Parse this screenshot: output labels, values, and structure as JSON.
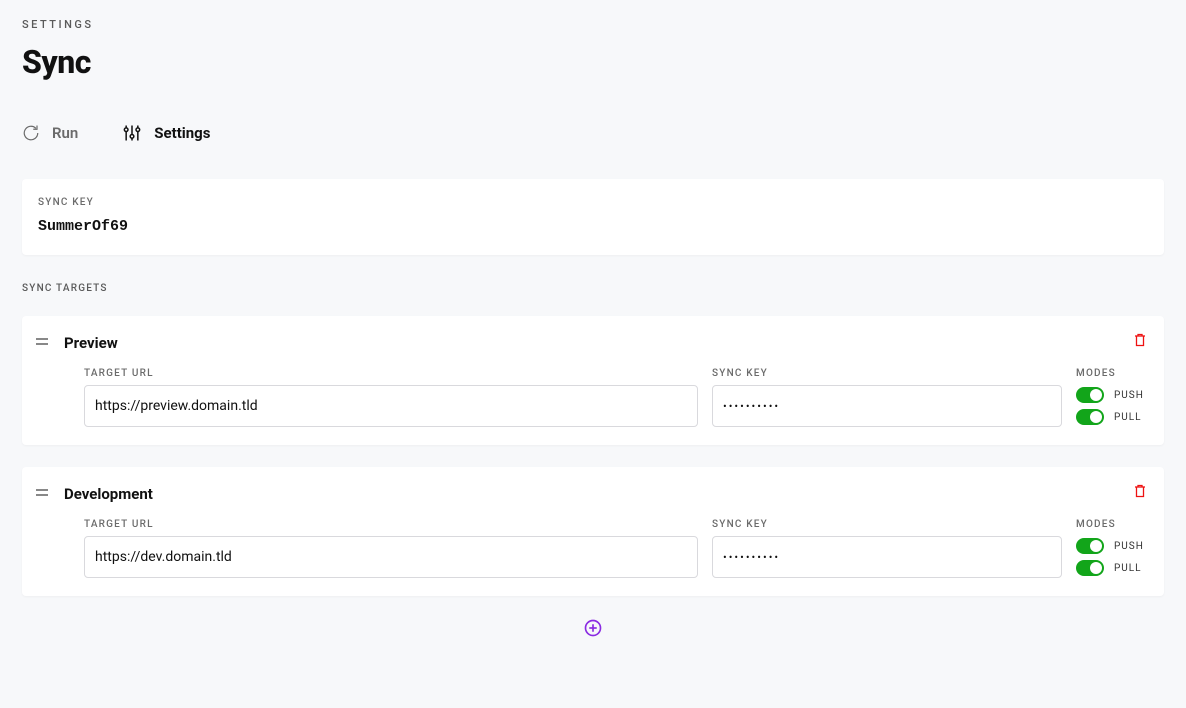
{
  "header": {
    "eyebrow": "SETTINGS",
    "title": "Sync"
  },
  "tabs": {
    "run": "Run",
    "settings": "Settings"
  },
  "sync_key_card": {
    "label": "SYNC KEY",
    "value": "SummerOf69"
  },
  "sync_targets_label": "SYNC TARGETS",
  "field_labels": {
    "target_url": "TARGET URL",
    "sync_key": "SYNC KEY",
    "modes": "MODES",
    "push": "PUSH",
    "pull": "PULL"
  },
  "targets": [
    {
      "name": "Preview",
      "url": "https://preview.domain.tld",
      "key": "••••••••••",
      "push": true,
      "pull": true
    },
    {
      "name": "Development",
      "url": "https://dev.domain.tld",
      "key": "••••••••••",
      "push": true,
      "pull": true
    }
  ]
}
